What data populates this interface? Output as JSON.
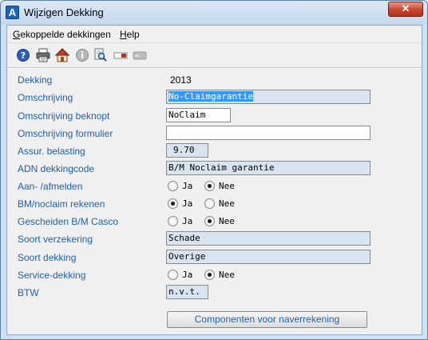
{
  "window": {
    "title": "Wijzigen Dekking",
    "app_icon_letter": "A",
    "close_glyph": "✕"
  },
  "menu": {
    "items": [
      {
        "underlined": "G",
        "rest": "ekoppelde dekkingen"
      },
      {
        "underlined": "H",
        "rest": "elp"
      }
    ]
  },
  "toolbar": {
    "icons": [
      "help-icon",
      "print-icon",
      "home-icon",
      "info-icon",
      "search-document-icon",
      "flag-icon",
      "card-icon"
    ]
  },
  "form": {
    "dekking": {
      "label": "Dekking",
      "value": "2013"
    },
    "omschrijving": {
      "label": "Omschrijving",
      "value": "No-Claimgarantie"
    },
    "omschrijving_beknopt": {
      "label": "Omschrijving beknopt",
      "value": "NoClaim"
    },
    "omschrijving_formulier": {
      "label": "Omschrijving formulier",
      "value": ""
    },
    "assur_belasting": {
      "label": "Assur. belasting",
      "value": "9.70"
    },
    "adn_dekkingcode": {
      "label": "ADN dekkingcode",
      "value": "B/M Noclaim garantie"
    },
    "aan_afmelden": {
      "label": "Aan- /afmelden",
      "options": [
        "Ja",
        "Nee"
      ],
      "selected": "Nee"
    },
    "bm_noclaim_rekenen": {
      "label": "BM/noclaim rekenen",
      "options": [
        "Ja",
        "Nee"
      ],
      "selected": "Ja"
    },
    "gescheiden_bm_casco": {
      "label": "Gescheiden B/M Casco",
      "options": [
        "Ja",
        "Nee"
      ],
      "selected": "Nee"
    },
    "soort_verzekering": {
      "label": "Soort verzekering",
      "value": "Schade"
    },
    "soort_dekking": {
      "label": "Soort dekking",
      "value": "Overige"
    },
    "service_dekking": {
      "label": "Service-dekking",
      "options": [
        "Ja",
        "Nee"
      ],
      "selected": "Nee"
    },
    "btw": {
      "label": "BTW",
      "value": "n.v.t."
    }
  },
  "buttons": {
    "componenten": "Componenten voor naverrekening"
  },
  "colors": {
    "label_blue": "#1f5fa8",
    "readonly_bg": "#d8e4f0",
    "selection": "#3399ff"
  }
}
